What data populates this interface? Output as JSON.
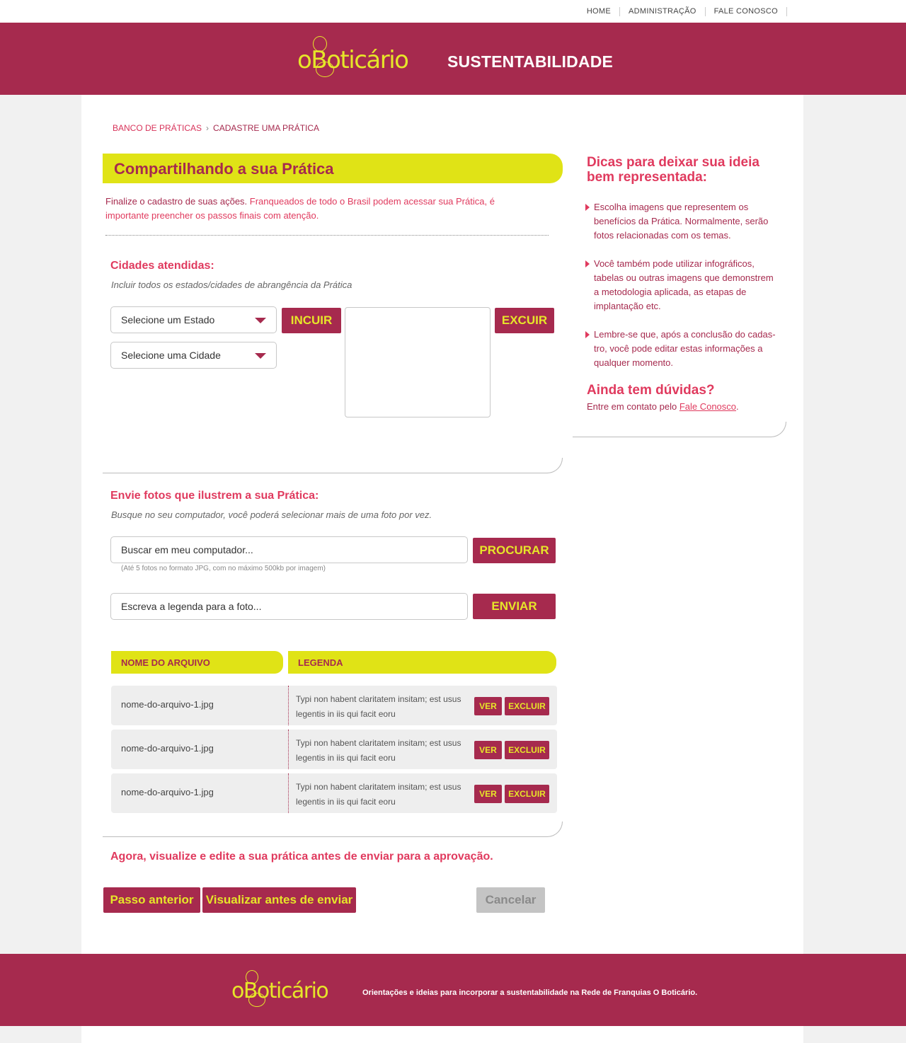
{
  "topnav": {
    "items": [
      "HOME",
      "ADMINISTRAÇÃO",
      "FALE CONOSCO"
    ]
  },
  "header": {
    "logo_text": "oBoticário",
    "site_title": "SUSTENTABILIDADE"
  },
  "breadcrumb": {
    "items": [
      "BANCO DE PRÁTICAS",
      "CADASTRE UMA PRÁTICA"
    ],
    "separator": "›"
  },
  "page": {
    "title": "Compartilhando a sua Prática",
    "intro_lead": "Finalize o cadastro de suas ações.",
    "intro_rest": " Franqueados de todo o Brasil podem acessar sua Prática, é importante preencher os passos finais com atenção."
  },
  "cities": {
    "title": "Cidades atendidas:",
    "subtitle": "Incluir todos os estados/cidades de abrangência da Prática",
    "state_select": "Selecione um Estado",
    "city_select": "Selecione uma Cidade",
    "include_button": "INCUIR",
    "exclude_button": "EXCUIR"
  },
  "photos": {
    "title": "Envie fotos que ilustrem a sua Prática:",
    "subtitle": "Busque no seu computador, você poderá selecionar mais de uma foto por vez.",
    "file_placeholder": "Buscar em meu computador...",
    "browse_button": "PROCURAR",
    "hint": "(Até 5 fotos no formato JPG, com no máximo 500kb por imagem)",
    "caption_placeholder": "Escreva a legenda para a foto...",
    "send_button": "ENVIAR",
    "table_headers": [
      "NOME DO ARQUIVO",
      "LEGENDA"
    ],
    "rows": [
      {
        "file": "nome-do-arquivo-1.jpg",
        "caption": "Typi non habent claritatem insitam; est usus legentis in iis qui facit eoru",
        "view": "VER",
        "delete": "EXCLUIR"
      },
      {
        "file": "nome-do-arquivo-1.jpg",
        "caption": "Typi non habent claritatem insitam; est usus legentis in iis qui facit eoru",
        "view": "VER",
        "delete": "EXCLUIR"
      },
      {
        "file": "nome-do-arquivo-1.jpg",
        "caption": "Typi non habent claritatem insitam; est usus legentis in iis qui facit eoru",
        "view": "VER",
        "delete": "EXCLUIR"
      }
    ]
  },
  "final": {
    "note": "Agora, visualize e edite a sua prática antes de enviar para a aprovação.",
    "prev_button": "Passo anterior",
    "preview_button": "Visualizar antes de enviar",
    "cancel_button": "Cancelar"
  },
  "sidebar": {
    "title": "Dicas para deixar sua ideia bem representada:",
    "tips": [
      "Escolha imagens que representem os benefícios da Prática. Normalmente, serão fotos relacionadas com os temas.",
      "Você também pode utilizar infográficos, tabelas ou outras imagens que demonstrem a metodologia aplicada, as etapas de implantação etc.",
      "Lembre-se que, após a conclusão do cadas-tro, você pode editar estas informações a qualquer momento."
    ],
    "help_title": "Ainda tem dúvidas?",
    "help_text": "Entre em contato pelo ",
    "help_link": "Fale Conosco",
    "help_end": "."
  },
  "footer": {
    "logo_text": "oBoticário",
    "tagline": "Orientações e ideias para incorporar a sustentabilidade na Rede de Franquias O Boticário."
  },
  "colors": {
    "brand": "#a62a4e",
    "accent": "#e0e316",
    "highlight": "#e03a5e"
  }
}
